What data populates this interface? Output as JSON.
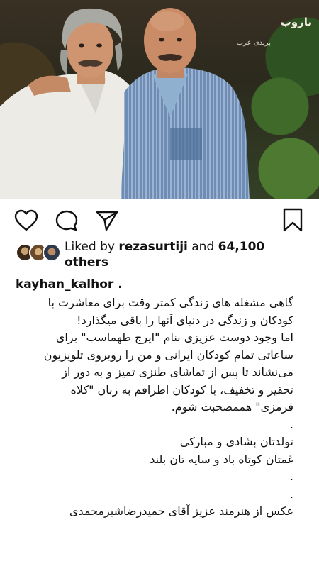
{
  "post": {
    "watermark": "نازوب",
    "signature": "برندی عرب"
  },
  "actions": {
    "like": "heart-icon",
    "comment": "comment-icon",
    "share": "share-icon",
    "save": "bookmark-icon"
  },
  "likes": {
    "prefix": "Liked by",
    "user": "rezasurtiji",
    "and": "and",
    "count": "64,100",
    "suffix": "others"
  },
  "caption": {
    "username": "kayhan_kalhor .",
    "lines": [
      "گاهی مشغله های زندگی کمتر وقت برای معاشرت با",
      "کودکان و زندگی در دنیای آنها را باقی میگذارد!",
      "اما وجود دوست عزیزی بنام \"ایرج طهماسب\" برای",
      "ساعاتی تمام کودکان ایرانی و من را روبروی تلویزیون",
      "می‌نشاند تا پس از تماشای طنزی تمیز و به دور از",
      "تحقیر و تخفیف، با کودکان اطرافم به زبان \"کلاه",
      "قرمزی\" هممصحبت شوم.",
      ".",
      "تولدتان بشادی و مبارکی",
      "غمتان کوتاه باد و سایه تان بلند",
      ".",
      ".",
      "عکس از هنرمند عزیز آقای حمیدرضاشیرمحمدی"
    ]
  },
  "colors": {
    "text": "#111111",
    "background": "#ffffff"
  }
}
